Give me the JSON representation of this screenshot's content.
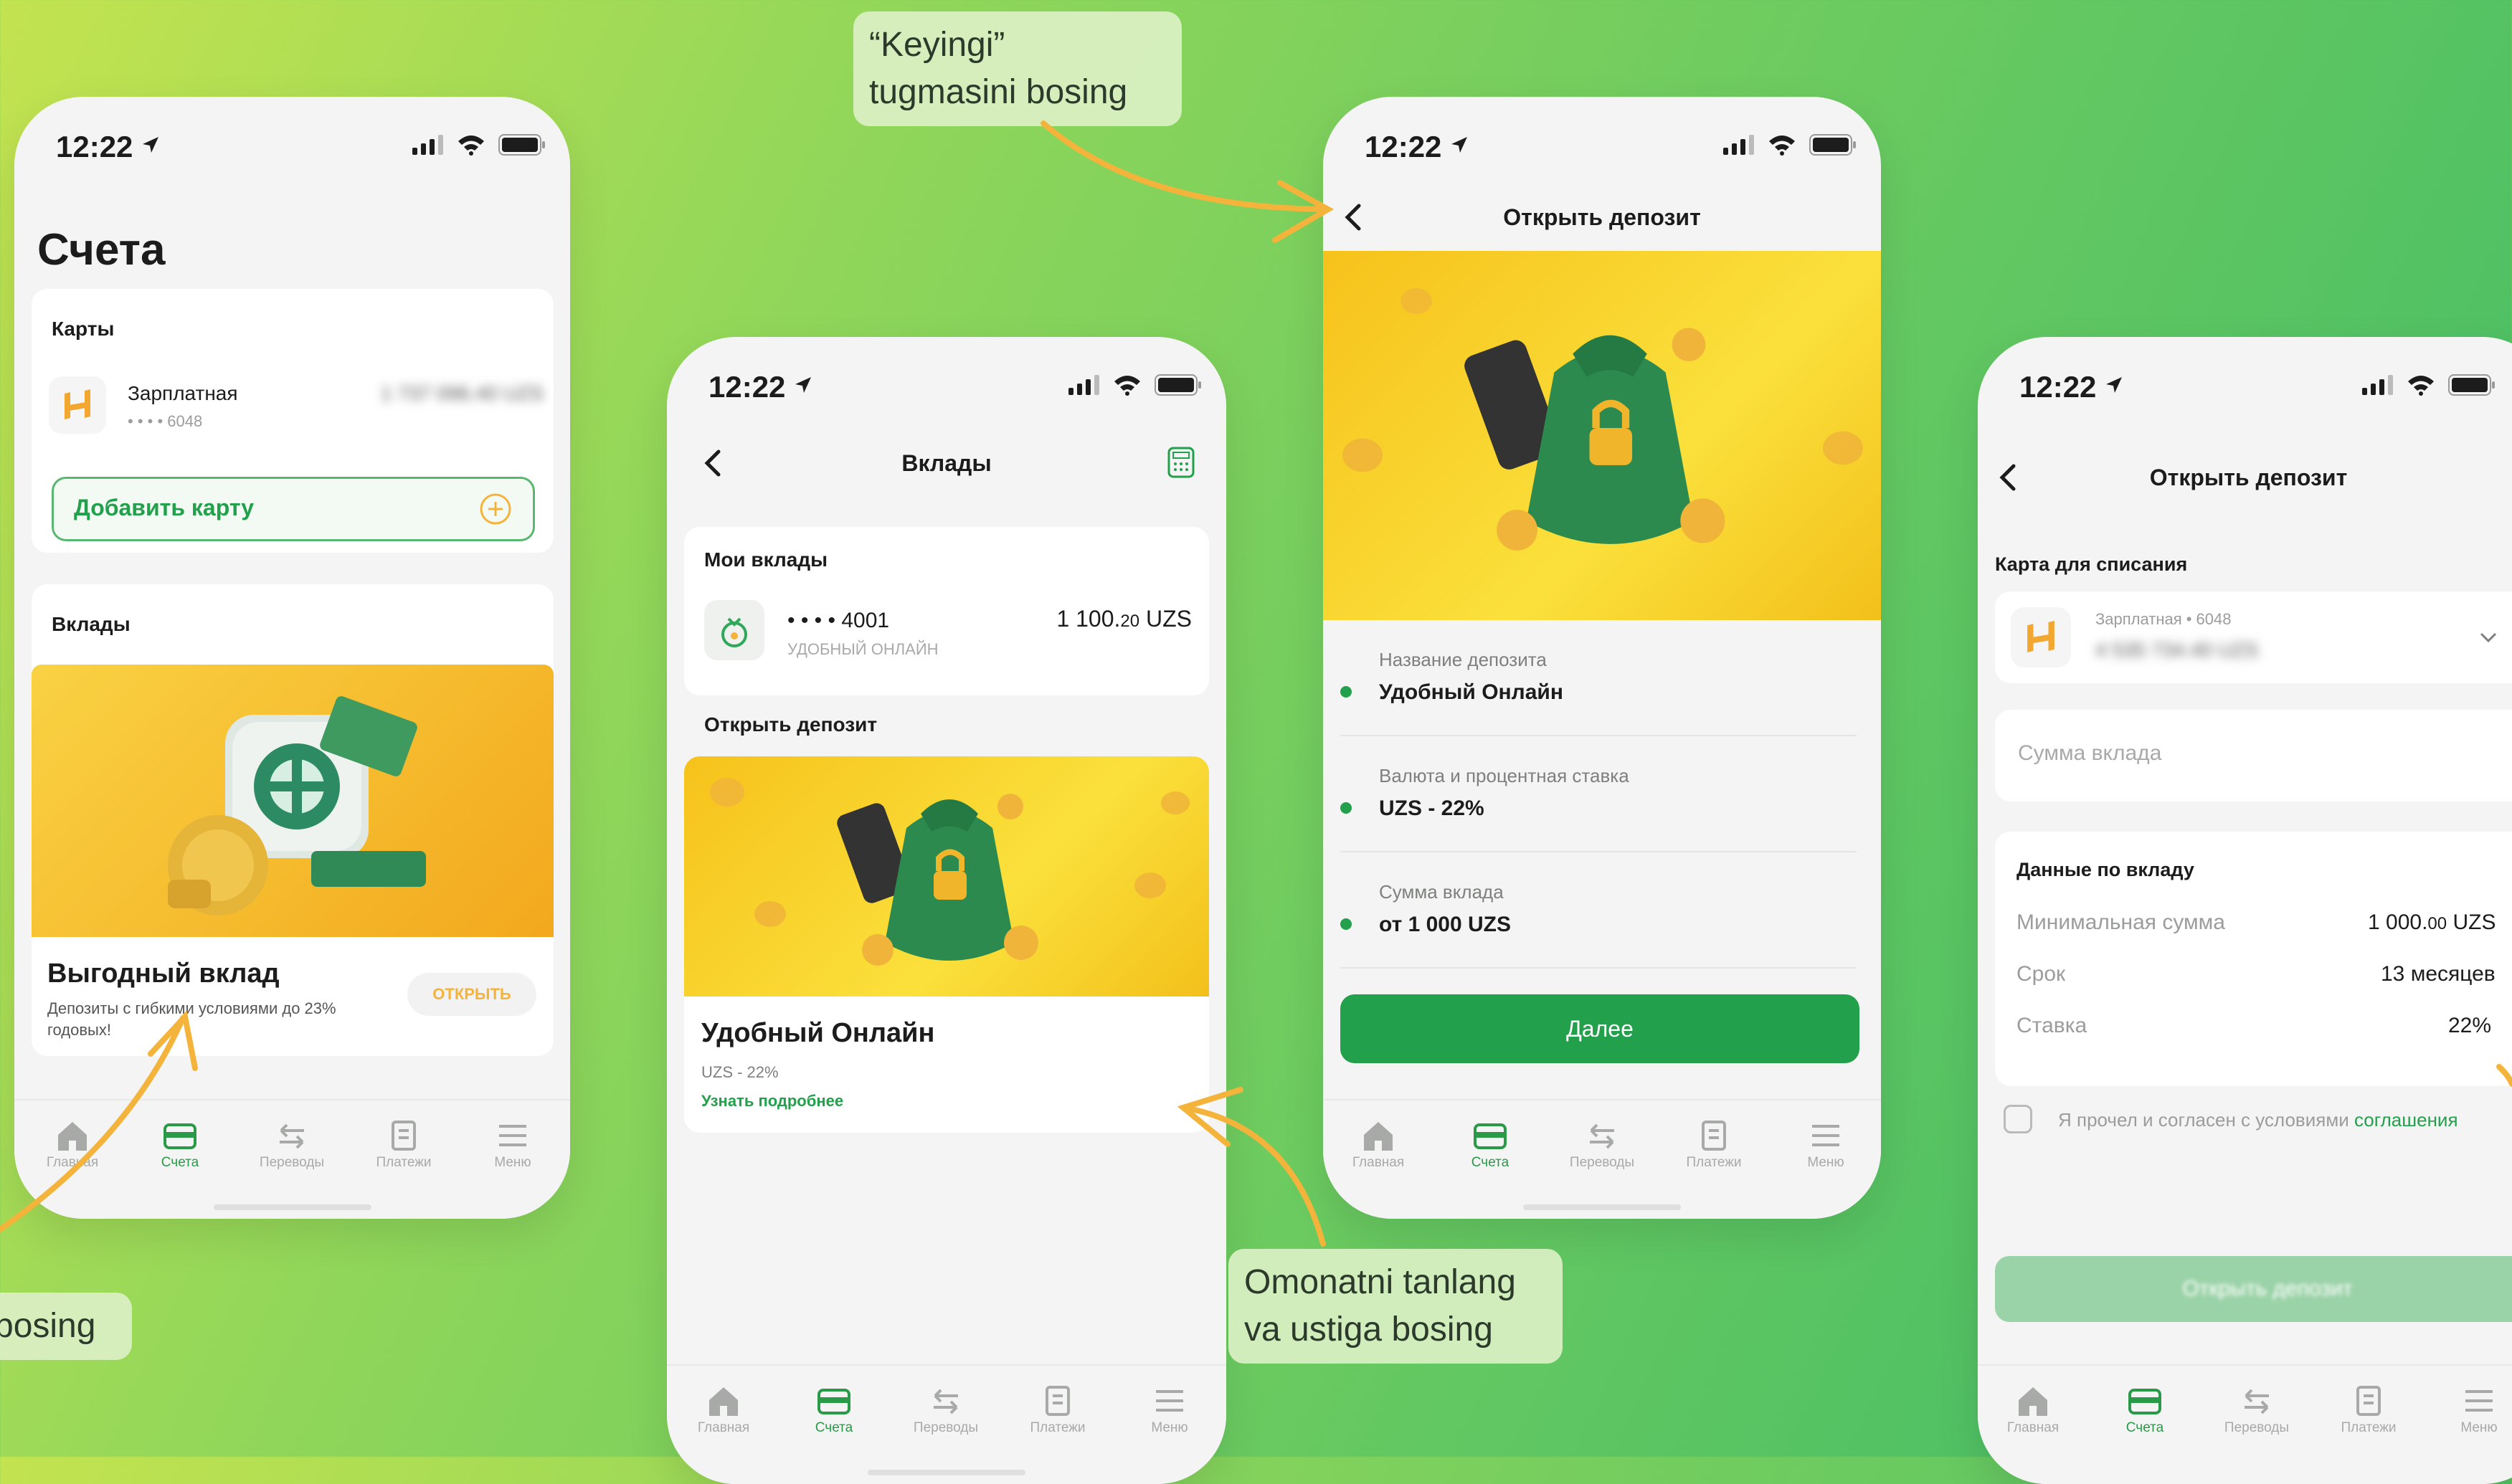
{
  "status": {
    "time": "12:22"
  },
  "tabs": [
    "Главная",
    "Счета",
    "Переводы",
    "Платежи",
    "Меню"
  ],
  "screen1": {
    "title": "Счета",
    "cards_header": "Карты",
    "card_name": "Зарплатная",
    "card_mask": "• • • • 6048",
    "card_balance": "1 737 096.40 UZS",
    "add_card": "Добавить карту",
    "deposits_header": "Вклады",
    "promo_title": "Выгодный вклад",
    "promo_desc": "Депозиты с гибкими условиями до 23% годовых!",
    "promo_button": "ОТКРЫТЬ"
  },
  "screen2": {
    "title": "Вклады",
    "my_deposits": "Мои вклады",
    "deposit_mask": "• • • • 4001",
    "deposit_type": "УДОБНЫЙ ОНЛАЙН",
    "deposit_amount": "1 100.",
    "deposit_amount_cents": "20",
    "deposit_currency": " UZS",
    "open_header": "Открыть депозит",
    "product_title": "Удобный Онлайн",
    "product_rate": "UZS - 22%",
    "product_link": "Узнать подробнее"
  },
  "screen3": {
    "title": "Открыть депозит",
    "name_label": "Название депозита",
    "name_value": "Удобный Онлайн",
    "rate_label": "Валюта и процентная ставка",
    "rate_value": "UZS - 22%",
    "sum_label": "Сумма вклада",
    "sum_value": "от 1 000 UZS",
    "next_button": "Далее"
  },
  "screen4": {
    "title": "Открыть депозит",
    "card_label": "Карта для списания",
    "card_name": "Зарплатная • 6048",
    "card_balance": "4 535 734.40 UZS",
    "amount_placeholder": "Сумма вклада",
    "details_header": "Данные по вкладу",
    "min_label": "Минимальная сумма",
    "min_value": "1 000.",
    "min_value_cents": "00",
    "min_currency": " UZS",
    "term_label": "Срок",
    "term_value": "13 месяцев",
    "rate_label": "Ставка",
    "rate_value": "22%",
    "agree_text": "Я прочел и согласен с условиями ",
    "agree_link": "соглашения",
    "submit_button": "Открыть депозит"
  },
  "callouts": {
    "keyingi_line1": "“Keyingi”",
    "keyingi_line2": "tugmasini bosing",
    "omonat_line1": "Omonatni tanlang",
    "omonat_line2": "va ustiga bosing",
    "left_fragment": "bosing"
  },
  "colors": {
    "brand_green": "#23a04b",
    "promo_yellow": "#f7c21a",
    "accent_orange": "#f4b43b"
  }
}
